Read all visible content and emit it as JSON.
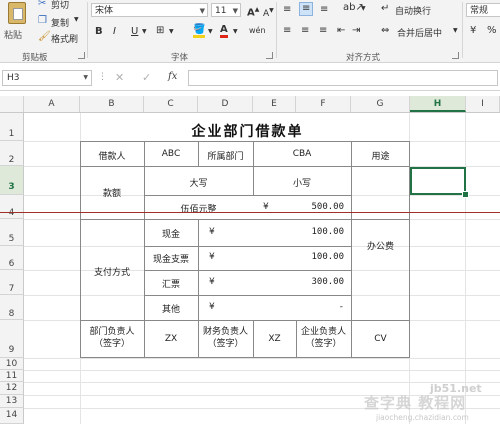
{
  "ribbon": {
    "clipboard": {
      "paste": "粘贴",
      "cut": "剪切",
      "copy": "复制",
      "format_painter": "格式刷",
      "group": "剪贴板"
    },
    "font": {
      "name": "宋体",
      "size": "11",
      "bold": "B",
      "italic": "I",
      "underline": "U",
      "wen": "wén",
      "group": "字体"
    },
    "alignment": {
      "wrap_text": "自动换行",
      "merge_center": "合并后居中",
      "group": "对齐方式"
    },
    "number": {
      "format": "常规"
    }
  },
  "formula_bar": {
    "name_box": "H3",
    "fx": "fx",
    "formula": ""
  },
  "columns": [
    "A",
    "B",
    "C",
    "D",
    "E",
    "F",
    "G",
    "H",
    "I"
  ],
  "rows": [
    "1",
    "2",
    "3",
    "4",
    "5",
    "6",
    "7",
    "8",
    "9",
    "10",
    "11",
    "12",
    "13",
    "14"
  ],
  "selected": {
    "cell": "H3",
    "column": "H",
    "row": "3"
  },
  "form": {
    "title": "企业部门借款单",
    "borrower_label": "借款人",
    "borrower": "ABC",
    "department_label": "所属部门",
    "department": "CBA",
    "purpose_label": "用途",
    "amount_label": "款额",
    "uppercase_label": "大写",
    "lowercase_label": "小写",
    "amount_words": "伍佰元整",
    "currency": "¥",
    "amount_number": "500.00",
    "payment_label": "支付方式",
    "methods": [
      {
        "name": "现金",
        "currency": "¥",
        "amount": "100.00"
      },
      {
        "name": "现金支票",
        "currency": "¥",
        "amount": "100.00"
      },
      {
        "name": "汇票",
        "currency": "¥",
        "amount": "300.00"
      },
      {
        "name": "其他",
        "currency": "¥",
        "amount": "-"
      }
    ],
    "purpose_value": "办公费",
    "dept_head_label": "部门负责人\n（签字）",
    "dept_head": "ZX",
    "finance_head_label": "财务负责人\n（签字）",
    "finance_head": "XZ",
    "company_head_label": "企业负责人\n（签字）",
    "company_head": "CV"
  },
  "watermark": {
    "site": "jb51.net",
    "brand": "查字典 教程网",
    "url": "jiaocheng.chazidian.com"
  }
}
